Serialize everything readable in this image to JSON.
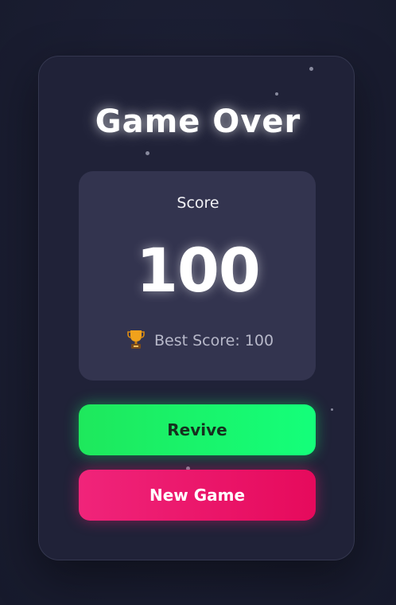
{
  "game_over": {
    "title": "Game Over",
    "score_label": "Score",
    "score_value": "100",
    "best_score_text": "Best Score: 100",
    "revive_label": "Revive",
    "new_game_label": "New Game"
  },
  "colors": {
    "background": "#1b1e33",
    "card": "#202238",
    "score_panel": "#33344f",
    "revive": "#1ee85c",
    "new_game": "#f0247a"
  },
  "icons": {
    "trophy": "trophy-icon"
  }
}
